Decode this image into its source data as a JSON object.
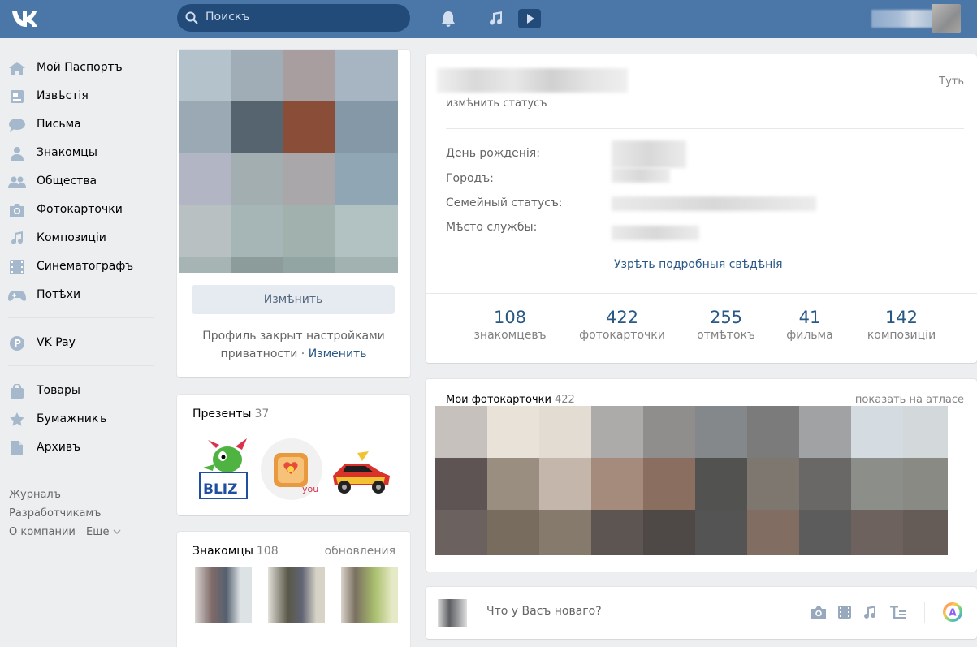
{
  "header": {
    "search_placeholder": "Поискъ"
  },
  "sidebar": {
    "items": [
      {
        "label": "Мой Паспортъ",
        "icon": "home-icon"
      },
      {
        "label": "Извѣстія",
        "icon": "news-icon"
      },
      {
        "label": "Письма",
        "icon": "messages-icon"
      },
      {
        "label": "Знакомцы",
        "icon": "user-icon"
      },
      {
        "label": "Общества",
        "icon": "groups-icon"
      },
      {
        "label": "Фотокарточки",
        "icon": "camera-icon"
      },
      {
        "label": "Композиціи",
        "icon": "music-icon"
      },
      {
        "label": "Синематографъ",
        "icon": "film-icon"
      },
      {
        "label": "Потѣхи",
        "icon": "gamepad-icon"
      }
    ],
    "vkpay": {
      "label": "VK Pay",
      "icon": "vkpay-icon"
    },
    "items2": [
      {
        "label": "Товары",
        "icon": "bag-icon"
      },
      {
        "label": "Бумажникъ",
        "icon": "star-icon"
      },
      {
        "label": "Архивъ",
        "icon": "document-icon"
      }
    ],
    "footer": [
      "Журналъ",
      "Разработчикамъ",
      "О компании",
      "Еще"
    ]
  },
  "profile": {
    "edit_button": "Измѣнить",
    "private_line1": "Профиль закрыт настройками",
    "private_line2": "приватности",
    "private_sep": " · ",
    "private_link": "Изменить"
  },
  "gifts": {
    "title": "Презенты",
    "count": "37"
  },
  "friends": {
    "title": "Знакомцы",
    "count": "108",
    "updates": "обновления"
  },
  "info": {
    "here": "Туть",
    "edit_status": "измѣнить статусъ",
    "rows": [
      {
        "label": "День рожденія:"
      },
      {
        "label": "Городъ:"
      },
      {
        "label": "Семейный статусъ:"
      },
      {
        "label": "Мѣсто службы:"
      }
    ],
    "more": "Узрѣть подробныя свѣдѣнія",
    "counters": [
      {
        "num": "108",
        "label": "знакомцевъ"
      },
      {
        "num": "422",
        "label": "фотокарточки"
      },
      {
        "num": "255",
        "label": "отмѣтокъ"
      },
      {
        "num": "41",
        "label": "фильма"
      },
      {
        "num": "142",
        "label": "композиціи"
      }
    ]
  },
  "photos": {
    "title": "Мои фотокарточки",
    "count": "422",
    "atlas": "показать на атласе"
  },
  "post": {
    "placeholder": "Что у Васъ новаго?"
  },
  "colors": {
    "header": "#4a76a8",
    "link": "#2a5885",
    "background": "#edeef0"
  }
}
